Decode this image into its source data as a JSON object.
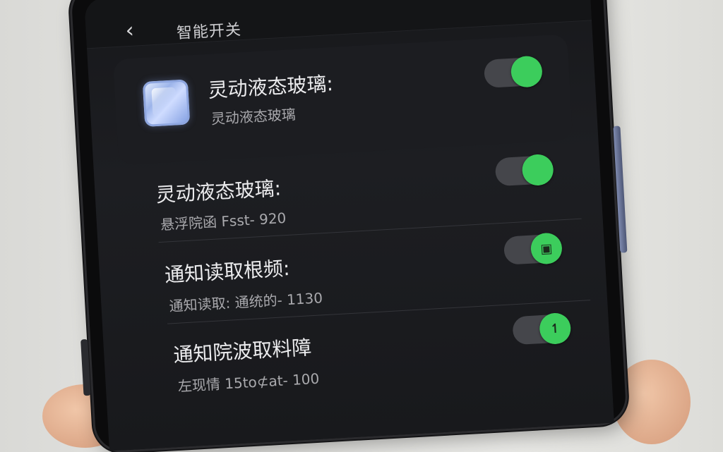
{
  "topbar": {
    "back_icon": "‹",
    "title": "智能开关"
  },
  "settings": [
    {
      "title": "灵动液态玻璃:",
      "subtitle": "灵动液态玻璃",
      "enabled": true,
      "knob_glyph": ""
    },
    {
      "title": "灵动液态玻璃:",
      "subtitle": "悬浮院函 Fsst- 920",
      "enabled": true,
      "knob_glyph": ""
    },
    {
      "title": "通知读取根频:",
      "subtitle": "通知读取: 通统的- 1130",
      "enabled": true,
      "knob_glyph": "▣"
    },
    {
      "title": "通知院波取料障",
      "subtitle": "左现情 15to⊄at- 100",
      "enabled": true,
      "knob_glyph": "↿"
    }
  ],
  "colors": {
    "toggle_on": "#3ccd5c",
    "toggle_track": "#45464b",
    "screen_bg": "#17181b"
  }
}
